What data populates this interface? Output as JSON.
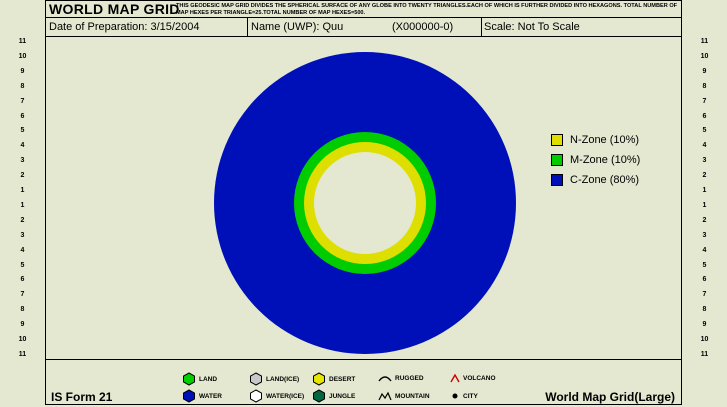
{
  "header": {
    "title": "WORLD MAP GRID",
    "description": "This geodesic map grid divides the spherical surface of any globe into twenty triangles.Each of which is further divided into hexagons. Total number of map hexes per triangle=25.Total number of map hexes=500."
  },
  "info": {
    "date_label": "Date of Preparation: 3/15/2004",
    "name_label": "Name (UWP): Quu",
    "uwp_code": "(X000000-0)",
    "scale_label": "Scale: Not To Scale"
  },
  "scale_ticks": [
    "11",
    "10",
    "9",
    "8",
    "7",
    "6",
    "5",
    "4",
    "3",
    "2",
    "1",
    "1",
    "2",
    "3",
    "4",
    "5",
    "6",
    "7",
    "8",
    "9",
    "10",
    "11"
  ],
  "zones": [
    {
      "label": "N-Zone (10%)",
      "color": "#dede00"
    },
    {
      "label": "M-Zone (10%)",
      "color": "#00cc00"
    },
    {
      "label": "C-Zone (80%)",
      "color": "#0010b8"
    }
  ],
  "footer": {
    "form_name": "IS Form 21",
    "grid_name": "World Map Grid(Large)",
    "legend": [
      {
        "label": "Land",
        "icon": "hex-land-icon",
        "color": "#00d000"
      },
      {
        "label": "Water",
        "icon": "hex-water-icon",
        "color": "#0010b8"
      },
      {
        "label": "Land(Ice)",
        "icon": "hex-land-ice-icon",
        "color": "#c8c8c8"
      },
      {
        "label": "Water(Ice)",
        "icon": "hex-water-ice-icon",
        "color": "#ffffff"
      },
      {
        "label": "Desert",
        "icon": "hex-desert-icon",
        "color": "#e6e600"
      },
      {
        "label": "Jungle",
        "icon": "hex-jungle-icon",
        "color": "#006840"
      },
      {
        "label": "Rugged",
        "icon": "rugged-icon",
        "color": "#000000"
      },
      {
        "label": "Mountain",
        "icon": "mountain-icon",
        "color": "#000000"
      },
      {
        "label": "Volcano",
        "icon": "volcano-icon",
        "color": "#cc0000"
      },
      {
        "label": "City",
        "icon": "city-icon",
        "color": "#000000"
      }
    ]
  }
}
